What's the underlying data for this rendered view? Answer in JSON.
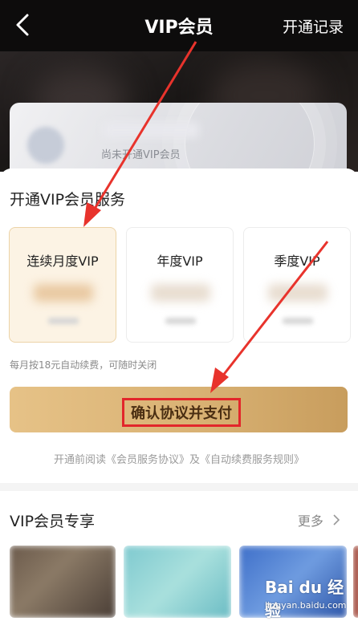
{
  "header": {
    "back_icon": "chevron-left-icon",
    "title": "VIP会员",
    "record_label": "开通记录"
  },
  "member_card": {
    "status": "尚未开通VIP会员"
  },
  "subscribe": {
    "section_title": "开通VIP会员服务",
    "plans": [
      {
        "name": "连续月度VIP",
        "selected": true
      },
      {
        "name": "年度VIP",
        "selected": false
      },
      {
        "name": "季度VIP",
        "selected": false
      }
    ],
    "plan_description": "每月按18元自动续费，可随时关闭",
    "confirm_label": "确认协议并支付",
    "agreement_text": "开通前阅读《会员服务协议》及《自动续费服务规则》"
  },
  "exclusive": {
    "title": "VIP会员专享",
    "more_label": "更多",
    "more_icon": "chevron-right-icon"
  },
  "watermark": {
    "logo": "Bai du 经验",
    "url": "jingyan.baidu.com"
  },
  "annotation": {
    "arrow_color": "#e8332c",
    "box_color": "#e2262b"
  }
}
